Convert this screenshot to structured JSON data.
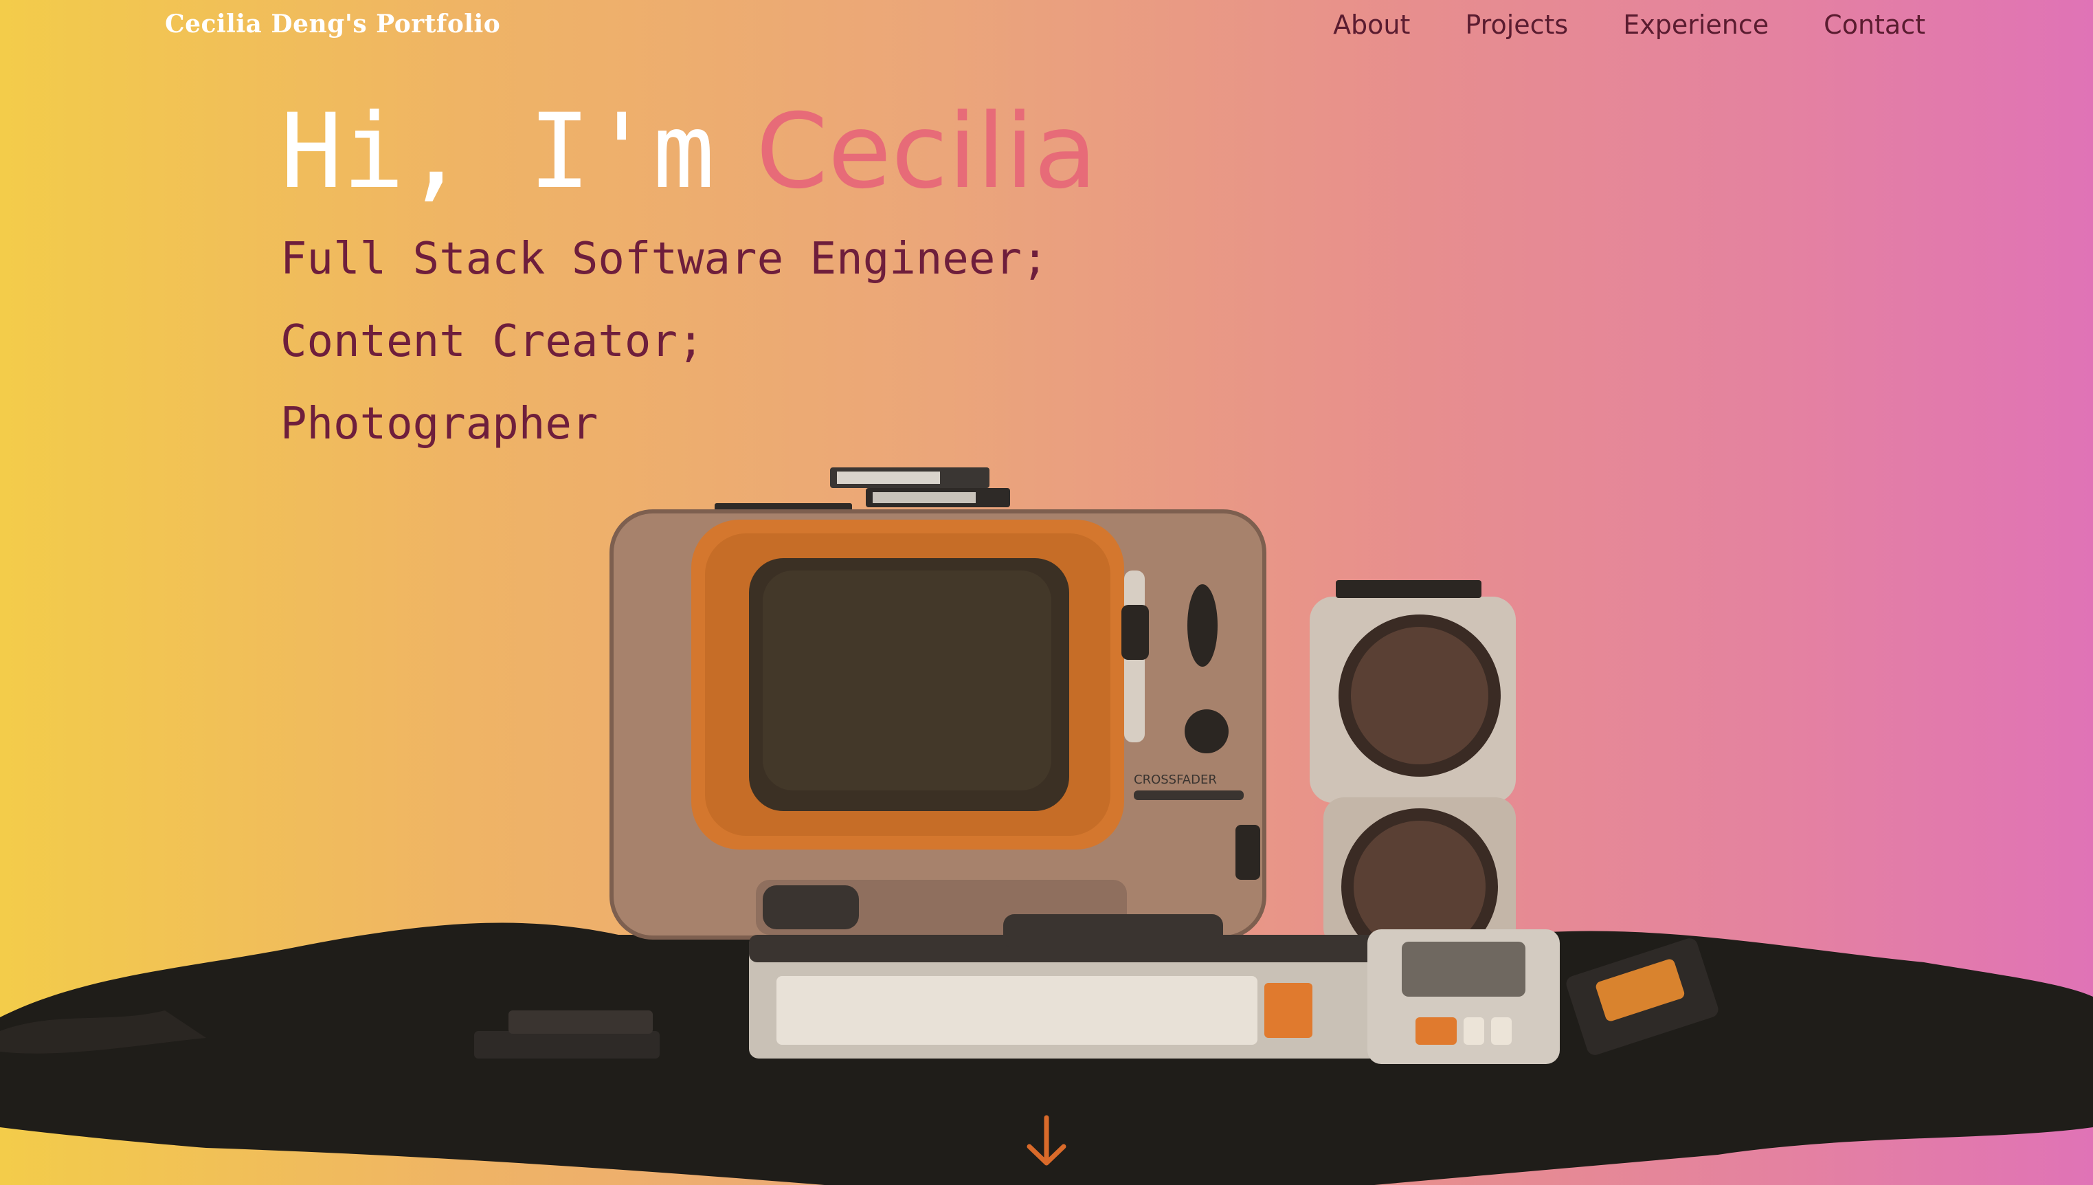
{
  "header": {
    "brand": "Cecilia Deng's  Portfolio",
    "nav": [
      "About",
      "Projects",
      "Experience",
      "Contact"
    ]
  },
  "hero": {
    "greeting": "Hi, I'm",
    "name": "Cecilia",
    "roles": [
      "Full Stack Software Engineer;",
      "Content Creator;",
      "Photographer"
    ]
  },
  "scroll": {
    "icon": "arrow-down-icon"
  },
  "colors": {
    "brand_text": "#ffffff",
    "nav_text": "#5a1c30",
    "name_accent": "#e76b78",
    "role_text": "#6e1e3c",
    "arrow": "#d96a2a"
  }
}
